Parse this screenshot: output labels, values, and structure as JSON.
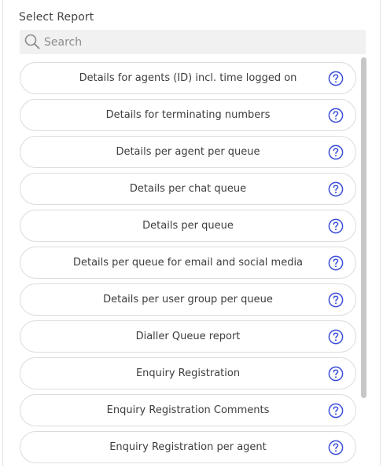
{
  "panel": {
    "title": "Select Report"
  },
  "search": {
    "placeholder": "Search",
    "value": ""
  },
  "colors": {
    "accent": "#3b4fd8",
    "search_bg": "#f1f1f1",
    "border": "#dcdcdc",
    "scrollbar": "#c7c7c7"
  },
  "reports": [
    {
      "label": "Details for agents (ID) incl. time logged on",
      "icon": "help-circle-icon"
    },
    {
      "label": "Details for terminating numbers",
      "icon": "help-circle-icon"
    },
    {
      "label": "Details per agent per queue",
      "icon": "help-circle-icon"
    },
    {
      "label": "Details per chat queue",
      "icon": "help-circle-icon"
    },
    {
      "label": "Details per queue",
      "icon": "help-circle-icon"
    },
    {
      "label": "Details per queue for email and social media",
      "icon": "help-circle-icon"
    },
    {
      "label": "Details per user group per queue",
      "icon": "help-circle-icon"
    },
    {
      "label": "Dialler Queue report",
      "icon": "help-circle-icon"
    },
    {
      "label": "Enquiry Registration",
      "icon": "help-circle-icon"
    },
    {
      "label": "Enquiry Registration Comments",
      "icon": "help-circle-icon"
    },
    {
      "label": "Enquiry Registration per agent",
      "icon": "help-circle-icon"
    }
  ]
}
